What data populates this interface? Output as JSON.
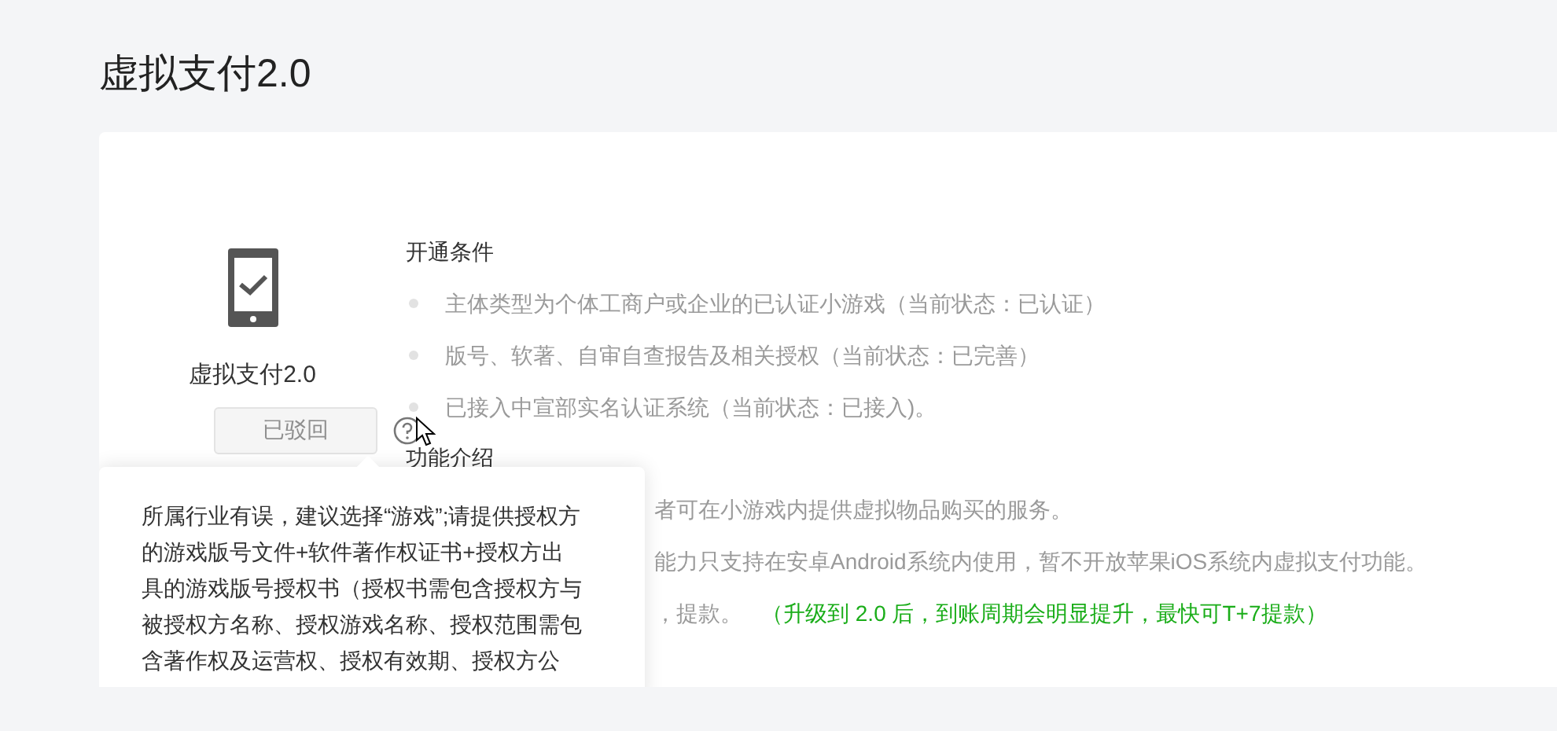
{
  "page": {
    "title": "虚拟支付2.0"
  },
  "product": {
    "name": "虚拟支付2.0",
    "status_button": {
      "label": "已驳回",
      "disabled": true
    }
  },
  "conditions": {
    "heading": "开通条件",
    "items": [
      "主体类型为个体工商户或企业的已认证小游戏（当前状态：已认证）",
      "版号、软著、自审自查报告及相关授权（当前状态：已完善）",
      "已接入中宣部实名认证系统（当前状态：已接入)。"
    ]
  },
  "features": {
    "heading": "功能介绍",
    "lines": [
      {
        "text": "者可在小游戏内提供虚拟物品购买的服务。"
      },
      {
        "text": "能力只支持在安卓Android系统内使用，暂不开放苹果iOS系统内虚拟支付功能。"
      },
      {
        "text": "，提款。",
        "highlight": "（升级到 2.0 后，到账周期会明显提升，最快可T+7提款）"
      }
    ]
  },
  "popover": {
    "text": "所属行业有误，建议选择“游戏”;请提供授权方的游戏版号文件+软件著作权证书+授权方出具的游戏版号授权书（授权书需包含授权方与被授权方名称、授权游戏名称、授权范围需包含著作权及运营权、授权有效期、授权方公"
  }
}
